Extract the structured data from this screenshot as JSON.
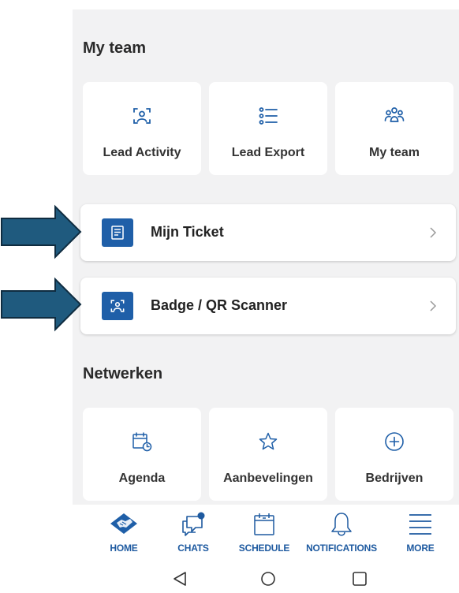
{
  "my_team": {
    "title": "My team",
    "tiles": [
      {
        "label": "Lead Activity",
        "icon": "scan-person-icon"
      },
      {
        "label": "Lead Export",
        "icon": "list-icon"
      },
      {
        "label": "My team",
        "icon": "group-icon"
      }
    ]
  },
  "rows": [
    {
      "label": "Mijn Ticket",
      "icon": "ticket-icon"
    },
    {
      "label": "Badge / QR Scanner",
      "icon": "scan-person-icon"
    }
  ],
  "netwerken": {
    "title": "Netwerken",
    "tiles": [
      {
        "label": "Agenda",
        "icon": "calendar-clock-icon"
      },
      {
        "label": "Aanbevelingen",
        "icon": "star-icon"
      },
      {
        "label": "Bedrijven",
        "icon": "plus-circle-icon"
      }
    ]
  },
  "tabbar": {
    "items": [
      {
        "label": "HOME",
        "icon": "handshake-icon"
      },
      {
        "label": "CHATS",
        "icon": "chat-icon"
      },
      {
        "label": "SCHEDULE",
        "icon": "calendar-icon"
      },
      {
        "label": "NOTIFICATIONS",
        "icon": "bell-icon"
      },
      {
        "label": "MORE",
        "icon": "menu-icon"
      }
    ]
  },
  "colors": {
    "accent": "#1f5fa8",
    "tab_label": "#1e5aa0",
    "arrow_fill": "#1f5a7e",
    "background": "#f2f2f3"
  }
}
